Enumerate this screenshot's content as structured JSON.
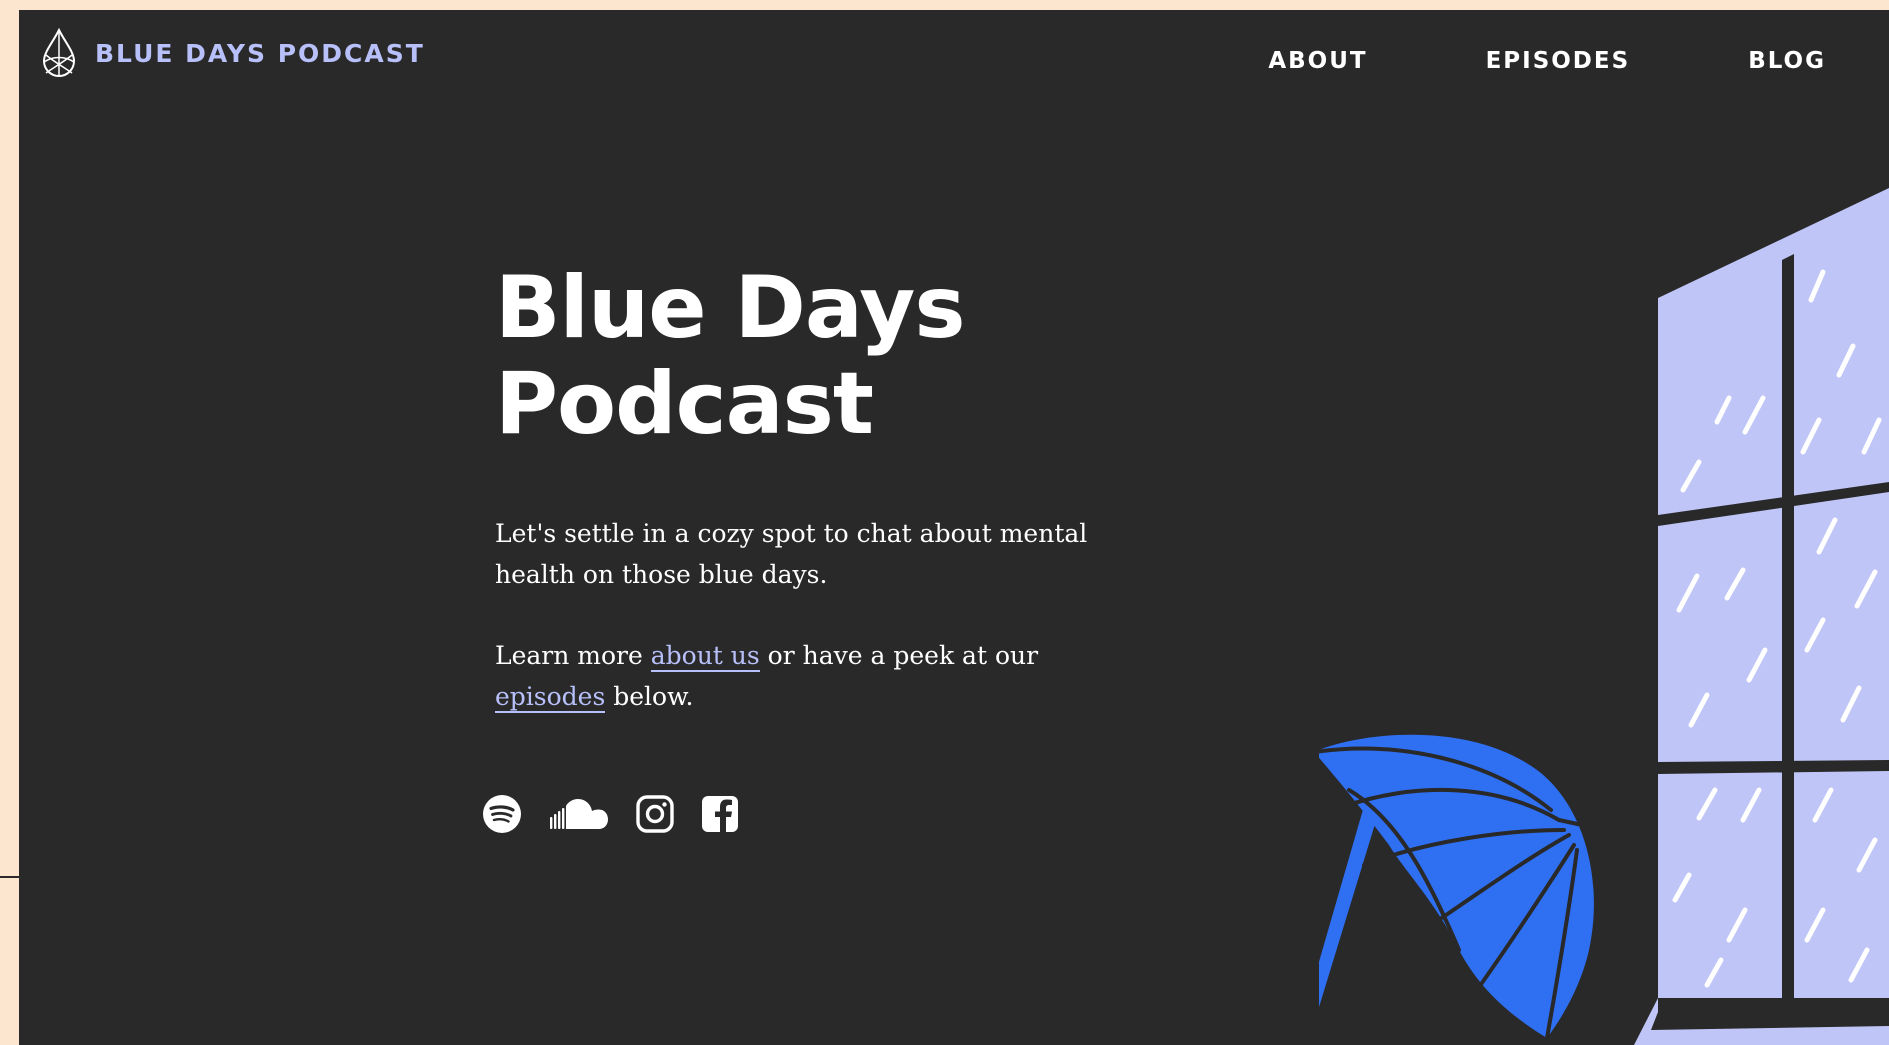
{
  "brand": {
    "name": "BLUE DAYS PODCAST",
    "logo_icon": "raindrop-logo-icon",
    "accent_color": "#b8c0fa"
  },
  "nav": {
    "items": [
      {
        "label": "ABOUT"
      },
      {
        "label": "EPISODES"
      },
      {
        "label": "BLOG"
      }
    ]
  },
  "hero": {
    "title_line1": "Blue Days",
    "title_line2": "Podcast",
    "paragraph1": "Let's settle in a cozy spot to chat about mental health on those blue days.",
    "paragraph2": {
      "prefix": "Learn more ",
      "link1": "about us",
      "middle": " or have a peek at our ",
      "link2": "episodes",
      "suffix": " below."
    }
  },
  "socials": [
    {
      "icon": "spotify-icon"
    },
    {
      "icon": "soundcloud-icon"
    },
    {
      "icon": "instagram-icon"
    },
    {
      "icon": "facebook-icon"
    }
  ],
  "colors": {
    "page_background": "#fde6cf",
    "panel_background": "#292929",
    "window_glass": "#bfc5f7",
    "umbrella": "#2f6ff2"
  }
}
